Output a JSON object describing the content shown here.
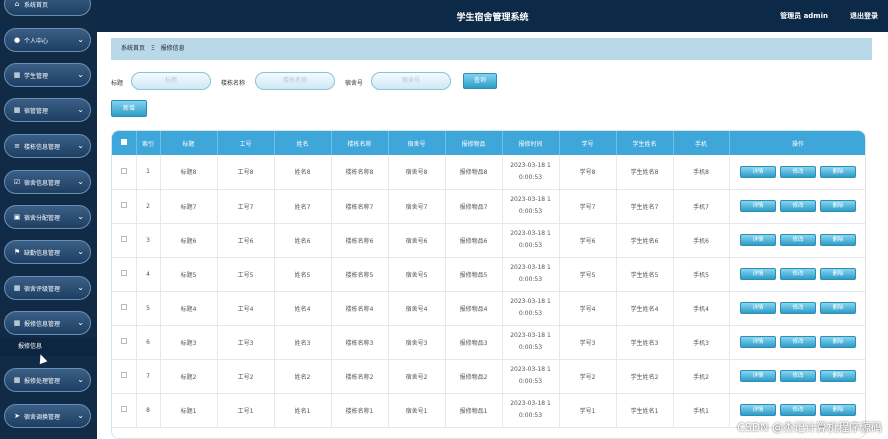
{
  "header": {
    "title": "学生宿舍管理系统",
    "admin": "管理员 admin",
    "logout": "退出登录"
  },
  "sidebar": {
    "items": [
      {
        "label": "系统首页",
        "icon": "home-icon"
      },
      {
        "label": "个人中心",
        "icon": "user-icon"
      },
      {
        "label": "学生管理",
        "icon": "grid-icon"
      },
      {
        "label": "宿管管理",
        "icon": "grid-icon"
      },
      {
        "label": "楼栋信息管理",
        "icon": "list-icon"
      },
      {
        "label": "宿舍信息管理",
        "icon": "checkbox-icon"
      },
      {
        "label": "宿舍分配管理",
        "icon": "lock-icon"
      },
      {
        "label": "缺勤信息管理",
        "icon": "flag-icon"
      },
      {
        "label": "宿舍评级管理",
        "icon": "grid-icon"
      },
      {
        "label": "报修信息管理",
        "icon": "grid-icon"
      },
      {
        "label": "报修处理管理",
        "icon": "grid-icon"
      },
      {
        "label": "宿舍调换管理",
        "icon": "send-icon"
      }
    ],
    "sub_item": "报修信息"
  },
  "breadcrumb": {
    "home": "系统首页",
    "separator": "Ξ",
    "current": "报修信息"
  },
  "search": {
    "title_label": "标题",
    "title_placeholder": "标题",
    "building_label": "楼栋名称",
    "building_placeholder": "楼栋名称",
    "dorm_label": "宿舍号",
    "dorm_placeholder": "宿舍号",
    "search_button": "查询"
  },
  "toolbar": {
    "add_button": "新增"
  },
  "table": {
    "columns": [
      "索引",
      "标题",
      "工号",
      "姓名",
      "楼栋名称",
      "宿舍号",
      "报修物品",
      "报修时间",
      "学号",
      "学生姓名",
      "手机",
      "操作"
    ],
    "actions": [
      "详情",
      "修改",
      "删除"
    ],
    "rows": [
      {
        "index": "1",
        "title": "标题8",
        "job_no": "工号8",
        "name": "姓名8",
        "building": "楼栋名称8",
        "dorm": "宿舍号8",
        "item": "报修物品8",
        "time1": "2023-03-18 1",
        "time2": "0:00:53",
        "student_no": "学号8",
        "student_name": "学生姓名8",
        "phone": "手机8"
      },
      {
        "index": "2",
        "title": "标题7",
        "job_no": "工号7",
        "name": "姓名7",
        "building": "楼栋名称7",
        "dorm": "宿舍号7",
        "item": "报修物品7",
        "time1": "2023-03-18 1",
        "time2": "0:00:53",
        "student_no": "学号7",
        "student_name": "学生姓名7",
        "phone": "手机7"
      },
      {
        "index": "3",
        "title": "标题6",
        "job_no": "工号6",
        "name": "姓名6",
        "building": "楼栋名称6",
        "dorm": "宿舍号6",
        "item": "报修物品6",
        "time1": "2023-03-18 1",
        "time2": "0:00:53",
        "student_no": "学号6",
        "student_name": "学生姓名6",
        "phone": "手机6"
      },
      {
        "index": "4",
        "title": "标题5",
        "job_no": "工号5",
        "name": "姓名5",
        "building": "楼栋名称5",
        "dorm": "宿舍号5",
        "item": "报修物品5",
        "time1": "2023-03-18 1",
        "time2": "0:00:53",
        "student_no": "学号5",
        "student_name": "学生姓名5",
        "phone": "手机5"
      },
      {
        "index": "5",
        "title": "标题4",
        "job_no": "工号4",
        "name": "姓名4",
        "building": "楼栋名称4",
        "dorm": "宿舍号4",
        "item": "报修物品4",
        "time1": "2023-03-18 1",
        "time2": "0:00:53",
        "student_no": "学号4",
        "student_name": "学生姓名4",
        "phone": "手机4"
      },
      {
        "index": "6",
        "title": "标题3",
        "job_no": "工号3",
        "name": "姓名3",
        "building": "楼栋名称3",
        "dorm": "宿舍号3",
        "item": "报修物品3",
        "time1": "2023-03-18 1",
        "time2": "0:00:53",
        "student_no": "学号3",
        "student_name": "学生姓名3",
        "phone": "手机3"
      },
      {
        "index": "7",
        "title": "标题2",
        "job_no": "工号2",
        "name": "姓名2",
        "building": "楼栋名称2",
        "dorm": "宿舍号2",
        "item": "报修物品2",
        "time1": "2023-03-18 1",
        "time2": "0:00:53",
        "student_no": "学号2",
        "student_name": "学生姓名2",
        "phone": "手机2"
      },
      {
        "index": "8",
        "title": "标题1",
        "job_no": "工号1",
        "name": "姓名1",
        "building": "楼栋名称1",
        "dorm": "宿舍号1",
        "item": "报修物品1",
        "time1": "2023-03-18 1",
        "time2": "0:00:53",
        "student_no": "学号1",
        "student_name": "学生姓名1",
        "phone": "手机1"
      }
    ]
  },
  "watermark": "CSDN @杰记计算机程序源码",
  "colors": {
    "header_bg": "#0c2a48",
    "sidebar_bg": "#112b47",
    "accent": "#3ea6d8",
    "breadcrumb_bg": "#b9d8e8"
  }
}
